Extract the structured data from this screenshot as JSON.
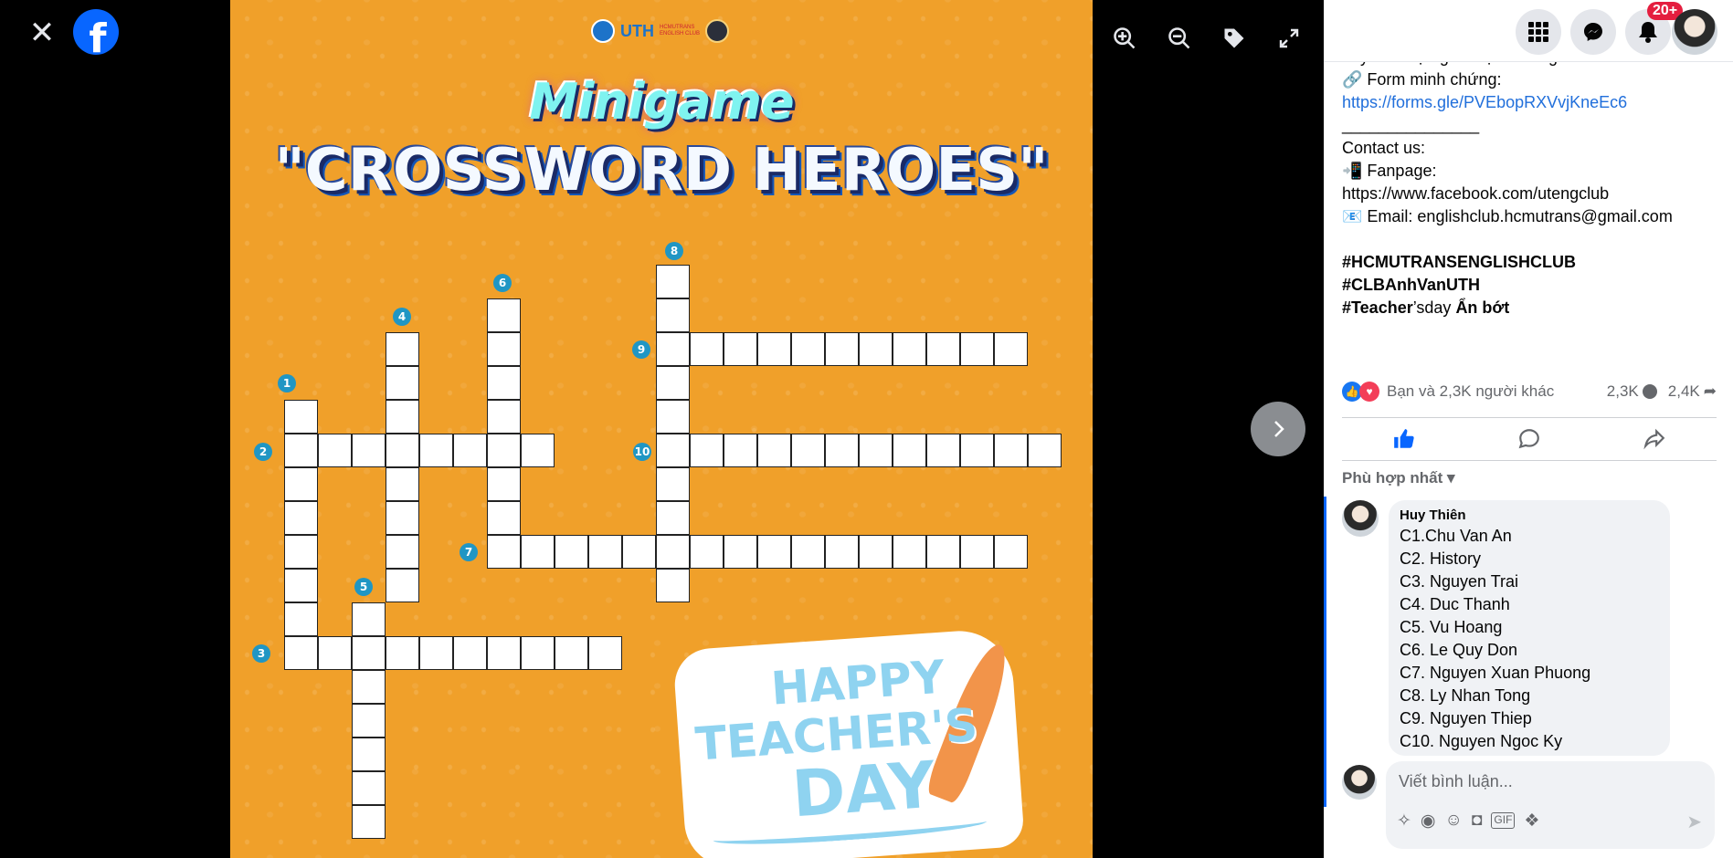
{
  "viewer": {
    "close_label": "✕",
    "logo_letter": "f"
  },
  "photo": {
    "org_logo_text": "UTH",
    "org_logo_small": "HCMUTRANS ENGLISH CLUB",
    "title_line1": "Minigame",
    "title_line2": "\"CROSSWORD HEROES\"",
    "sticker_line1": "HAPPY",
    "sticker_line2": "TEACHER'S",
    "sticker_line3": "DAY",
    "clue_numbers": [
      "1",
      "2",
      "3",
      "4",
      "5",
      "6",
      "7",
      "8",
      "9",
      "10"
    ]
  },
  "toolbar": {
    "zoom_in": "zoom-in",
    "zoom_out": "zoom-out",
    "tag": "tag",
    "fullscreen": "fullscreen"
  },
  "topnav": {
    "notifications_badge": "20+"
  },
  "post": {
    "line_truncated": "đây để được ghi nhận tham gia",
    "form_label": "🔗 Form minh chứng:",
    "form_link": "https://forms.gle/PVEbopRXVvjKneEc6",
    "separator": "_______________",
    "contact": "Contact us:",
    "fanpage_label": "📲 Fanpage:",
    "fanpage_link": "https://www.facebook.com/utengclub",
    "email": "📧 Email: englishclub.hcmutrans@gmail.com",
    "tag1": "#HCMUTRANSENGLISHCLUB",
    "tag2": "#CLBAnhVanUTH",
    "tag3": "#Teacher",
    "tag3_suffix": "’sday",
    "see_less": "Ẩn bớt"
  },
  "reactions": {
    "summary": "Bạn và 2,3K người khác",
    "comments": "2,3K",
    "shares": "2,4K"
  },
  "sort": {
    "label": "Phù hợp nhất"
  },
  "comment": {
    "author": "Huy Thiên",
    "lines": [
      "C1.Chu Van An",
      "C2. History",
      "C3. Nguyen Trai",
      "C4. Duc Thanh",
      "C5. Vu Hoang",
      "C6. Le Quy Don",
      "C7. Nguyen Xuan Phuong",
      "C8. Ly Nhan Tong",
      "C9. Nguyen Thiep",
      "C10. Nguyen Ngoc Ky"
    ]
  },
  "composer": {
    "placeholder": "Viết bình luận..."
  }
}
